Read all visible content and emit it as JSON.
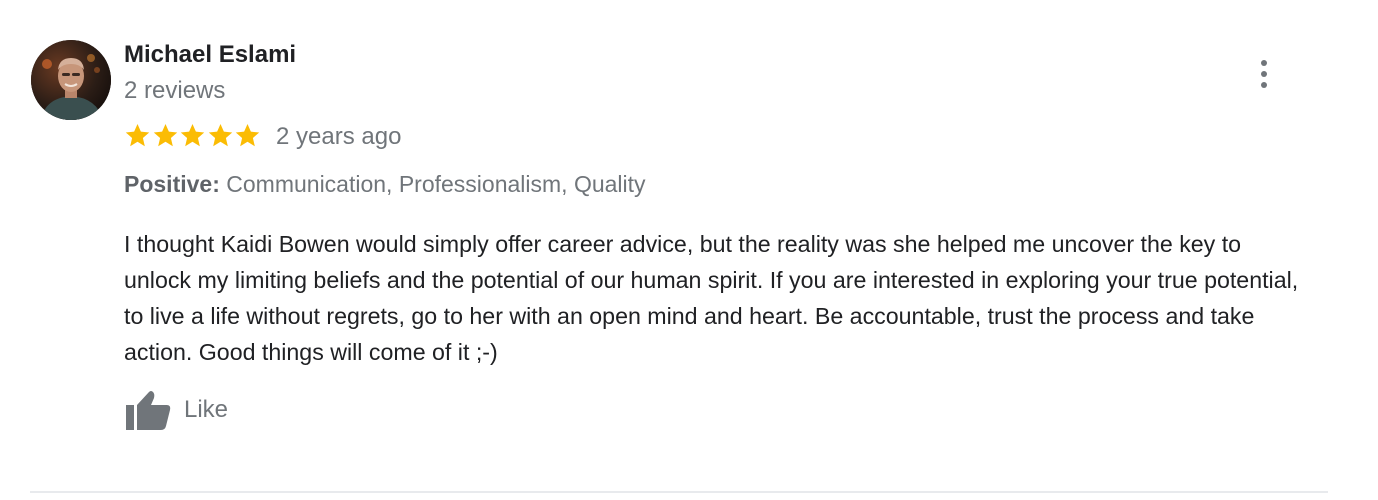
{
  "review": {
    "author": {
      "name": "Michael Eslami",
      "review_count": "2 reviews",
      "avatar_icon": "user-avatar-photo"
    },
    "rating": {
      "stars": 5,
      "max_stars": 5,
      "star_color": "#fbbc04",
      "star_icon": "star-icon"
    },
    "time_ago": "2 years ago",
    "attributes": {
      "label": "Positive:",
      "values": " Communication, Professionalism, Quality"
    },
    "text": "I thought Kaidi Bowen would simply offer career advice, but the reality was she helped me uncover the key to unlock my limiting beliefs and the potential of our human spirit. If you are interested in exploring your true potential, to live a life without regrets, go to her with an open mind and heart. Be accountable, trust the process and take action. Good things will come of it ;-)",
    "actions": {
      "like_label": "Like",
      "like_icon": "thumbs-up-icon",
      "more_icon": "more-vert-icon"
    }
  },
  "colors": {
    "primary_text": "#202124",
    "secondary_text": "#70757a",
    "divider": "#e8eaed"
  }
}
